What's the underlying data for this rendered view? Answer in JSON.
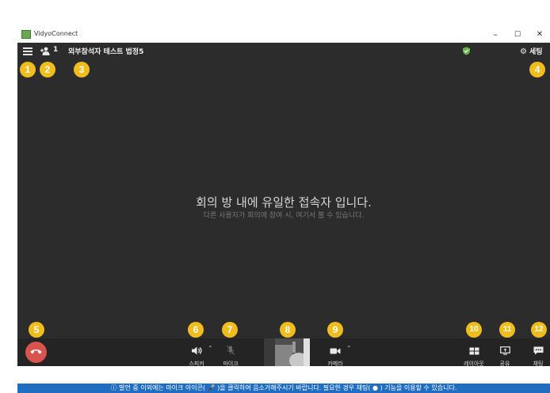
{
  "window": {
    "app_title": "VidyoConnect",
    "minimize": "–",
    "maximize": "☐",
    "close": "✕"
  },
  "topbar": {
    "participant_count": "1",
    "room_name": "외부참석자 테스트 법정5",
    "settings_label": "세팅"
  },
  "main": {
    "message": "회의 방 내에 유일한 접속자 입니다.",
    "sub_message": "다른 사용자가 회의에 참여 시, 여기서 볼 수 있습니다."
  },
  "controls": {
    "speaker_label": "스피커",
    "mic_label": "마이크",
    "camera_label": "카메라",
    "layout_label": "레이아웃",
    "share_label": "공유",
    "chat_label": "채팅"
  },
  "statusbar": {
    "text": "ⓘ 발언 중 이외에는 마이크 아이콘( 🎤 )을 클릭하여 음소거해주시기 바랍니다. 필요한 경우 채팅( ● ) 기능을 이용할 수 있습니다."
  },
  "badges": [
    "1",
    "2",
    "3",
    "4",
    "5",
    "6",
    "7",
    "8",
    "9",
    "10",
    "11",
    "12"
  ],
  "colors": {
    "badge": "#f0bd1e",
    "hangup": "#d9534f",
    "status_bar": "#1f6ec2",
    "stage_bg": "#2c2c2c",
    "secure_icon": "#6ab04c"
  }
}
